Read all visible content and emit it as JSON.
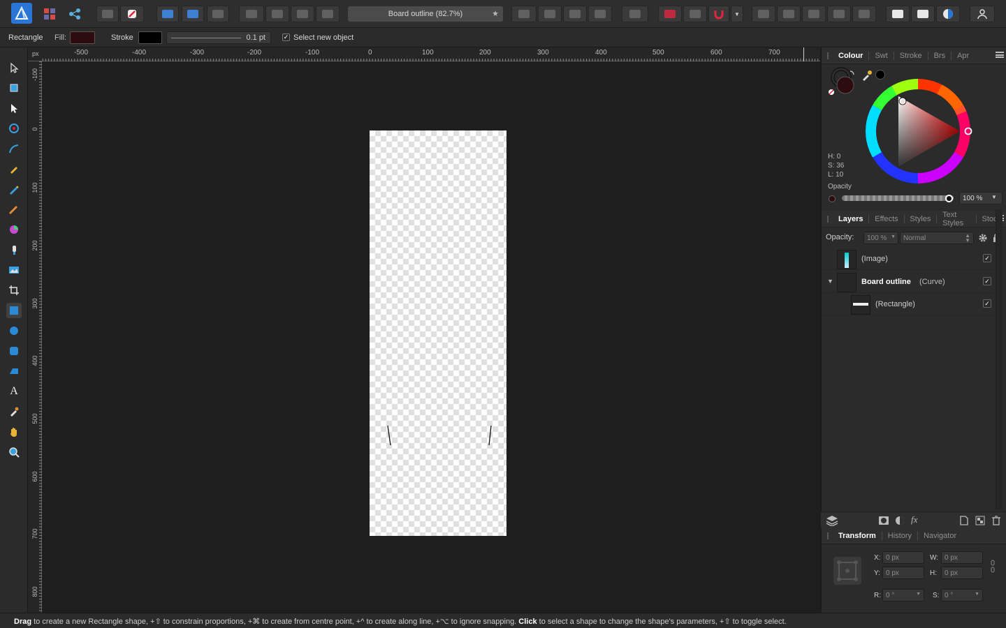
{
  "toolbar": {
    "document_title": "Board outline (82.7%)"
  },
  "context": {
    "tool_name": "Rectangle",
    "fill_label": "Fill:",
    "fill_color": "#2d0b0f",
    "stroke_label": "Stroke",
    "stroke_color": "#000000",
    "stroke_width": "0.1 pt",
    "select_new_object_label": "Select new object",
    "select_new_object_checked": true
  },
  "rulers": {
    "unit": "px",
    "horizontal_ticks": [
      "-500",
      "-400",
      "-300",
      "-200",
      "-100",
      "0",
      "100",
      "200",
      "300",
      "400",
      "500",
      "600",
      "700"
    ],
    "vertical_ticks": [
      "-100",
      "0",
      "100",
      "200",
      "300",
      "400",
      "500",
      "600",
      "700",
      "800"
    ]
  },
  "colour_panel": {
    "tabs": [
      "Colour",
      "Swt",
      "Stroke",
      "Brs",
      "Apr"
    ],
    "active_tab": "Colour",
    "h": "H: 0",
    "s": "S: 36",
    "l": "L: 10",
    "opacity_label": "Opacity",
    "opacity_value": "100 %"
  },
  "layers_panel": {
    "tabs": [
      "Layers",
      "Effects",
      "Styles",
      "Text Styles",
      "Stock"
    ],
    "active_tab": "Layers",
    "opacity_label": "Opacity:",
    "opacity_value": "100 %",
    "blend_mode": "Normal",
    "layers": [
      {
        "name": "(Image)",
        "type": "",
        "visible": true
      },
      {
        "name": "Board outline",
        "type": "(Curve)",
        "visible": true
      },
      {
        "name": "(Rectangle)",
        "type": "",
        "visible": true
      }
    ]
  },
  "transform_panel": {
    "tabs": [
      "Transform",
      "History",
      "Navigator"
    ],
    "active_tab": "Transform",
    "x_label": "X:",
    "x_value": "0 px",
    "y_label": "Y:",
    "y_value": "0 px",
    "w_label": "W:",
    "w_value": "0 px",
    "h_label": "H:",
    "h_value": "0 px",
    "r_label": "R:",
    "r_value": "0 °",
    "s_label": "S:",
    "s_value": "0 °"
  },
  "status": {
    "p1": "Drag",
    "p2": " to create a new Rectangle shape, +⇧ to constrain proportions, +⌘ to create from centre point, +^ to create along line, +⌥ to ignore snapping. ",
    "p3": "Click",
    "p4": " to select a shape to change the shape's parameters, +⇧ to toggle select."
  }
}
